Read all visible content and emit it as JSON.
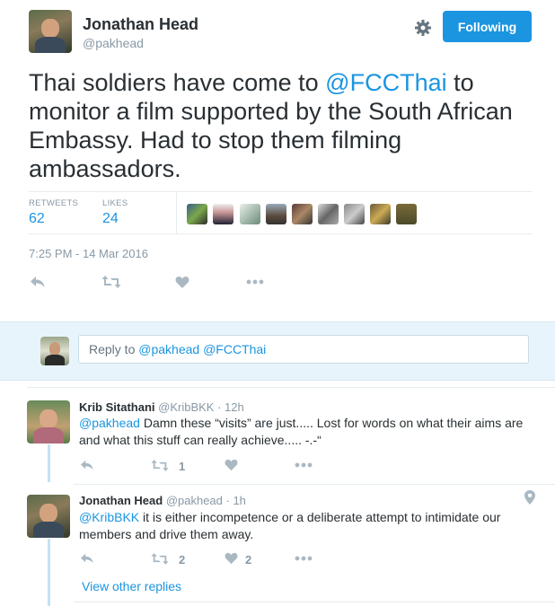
{
  "tweet": {
    "author_name": "Jonathan Head",
    "author_handle": "@pakhead",
    "follow_label": "Following",
    "text_before": "Thai soldiers have come to ",
    "mention": "@FCCThai",
    "text_after": " to monitor a film supported by the South African Embassy. Had to stop them filming ambassadors.",
    "retweets_label": "RETWEETS",
    "retweets_count": "62",
    "likes_label": "LIKES",
    "likes_count": "24",
    "timestamp": "7:25 PM - 14 Mar 2016",
    "icons": [
      "reply-icon",
      "retweet-icon",
      "like-icon",
      "more-icon",
      "gear-icon"
    ]
  },
  "reply_box": {
    "prefix": "Reply to ",
    "mentions": "@pakhead @FCCThai"
  },
  "replies": [
    {
      "name": "Krib Sitathani",
      "handle": "@KribBKK",
      "time": "· 12h",
      "mention": "@pakhead",
      "text": " Damn these “visits” are just..... Lost for words on what their aims are and what this stuff can really achieve..... -.-“",
      "retweets": "1",
      "likes": ""
    },
    {
      "name": "Jonathan Head",
      "handle": "@pakhead",
      "time": "· 1h",
      "mention": "@KribBKK",
      "text": " it is either incompetence or a deliberate attempt to intimidate our members and drive them away.",
      "retweets": "2",
      "likes": "2"
    }
  ],
  "view_other_replies": "View other replies",
  "colors": {
    "accent": "#1b95e0",
    "muted": "#8899a6",
    "reply_bg": "#e8f4fb"
  }
}
